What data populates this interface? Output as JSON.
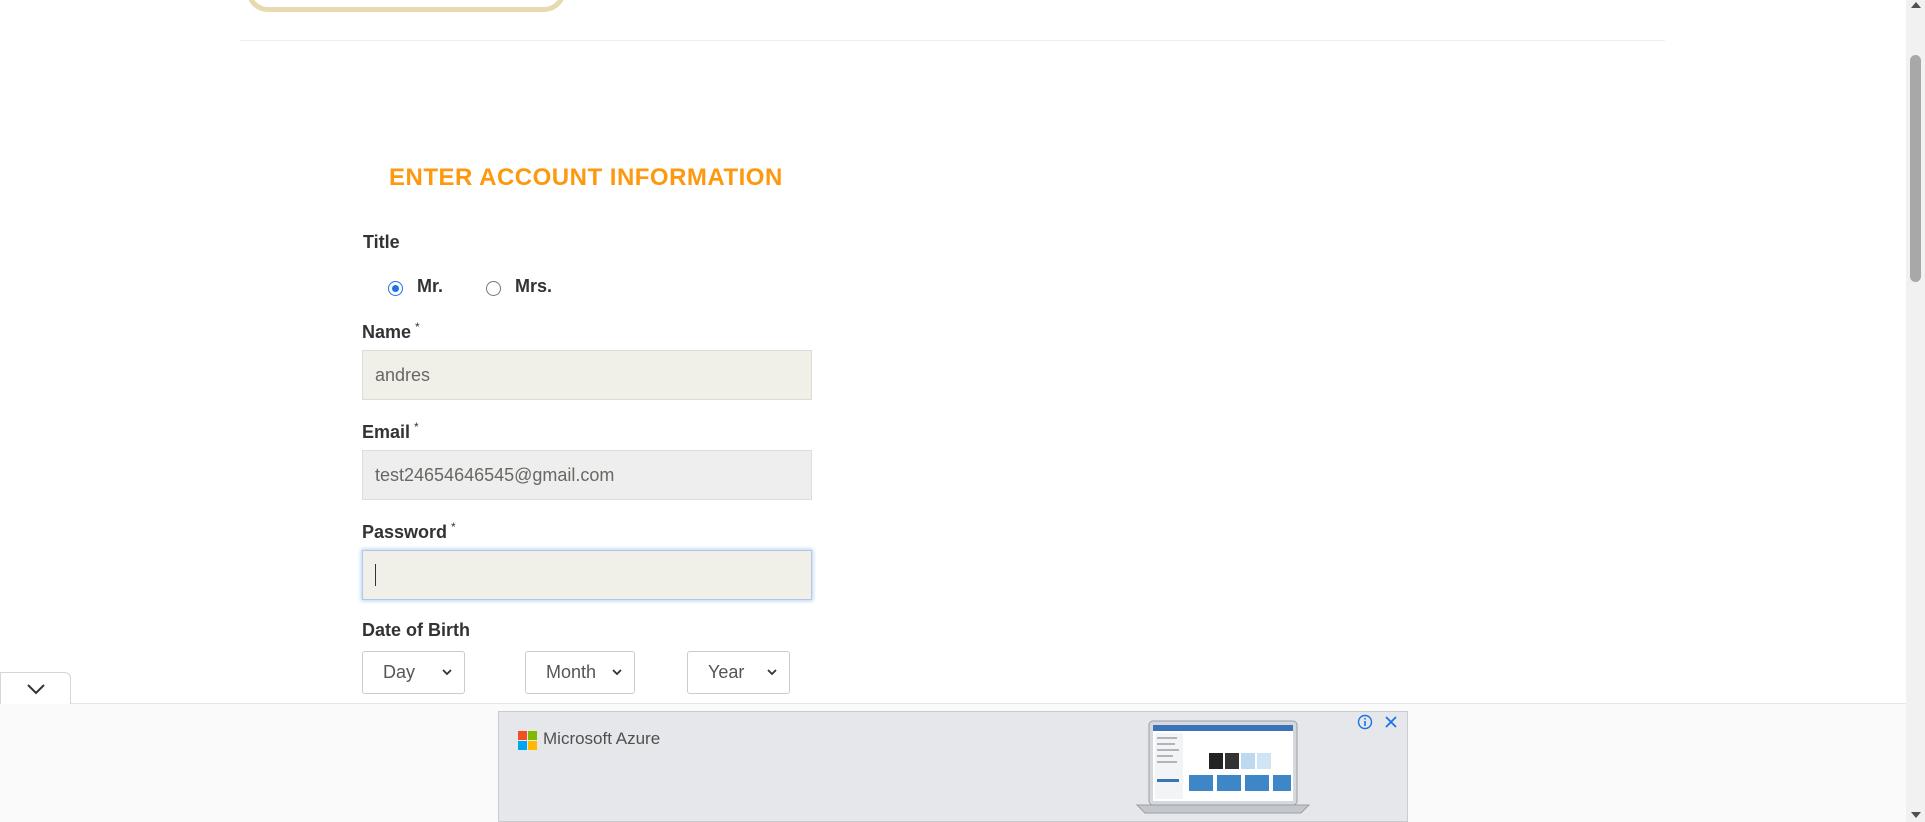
{
  "form": {
    "title": "ENTER ACCOUNT INFORMATION",
    "title_field": {
      "label": "Title",
      "options": [
        {
          "label": "Mr.",
          "checked": true
        },
        {
          "label": "Mrs.",
          "checked": false
        }
      ]
    },
    "name": {
      "label": "Name",
      "required_mark": "*",
      "value": "andres"
    },
    "email": {
      "label": "Email",
      "required_mark": "*",
      "value": "test24654646545@gmail.com"
    },
    "password": {
      "label": "Password",
      "required_mark": "*",
      "value": ""
    },
    "dob": {
      "label": "Date of Birth",
      "day": "Day",
      "month": "Month",
      "year": "Year"
    }
  },
  "ad": {
    "brand": "Microsoft Azure",
    "info_icon": "info-icon",
    "close_icon": "close-icon"
  },
  "colors": {
    "accent": "#fe980f",
    "radio_checked": "#1a73e8",
    "input_bg": "#f0f0e9"
  }
}
